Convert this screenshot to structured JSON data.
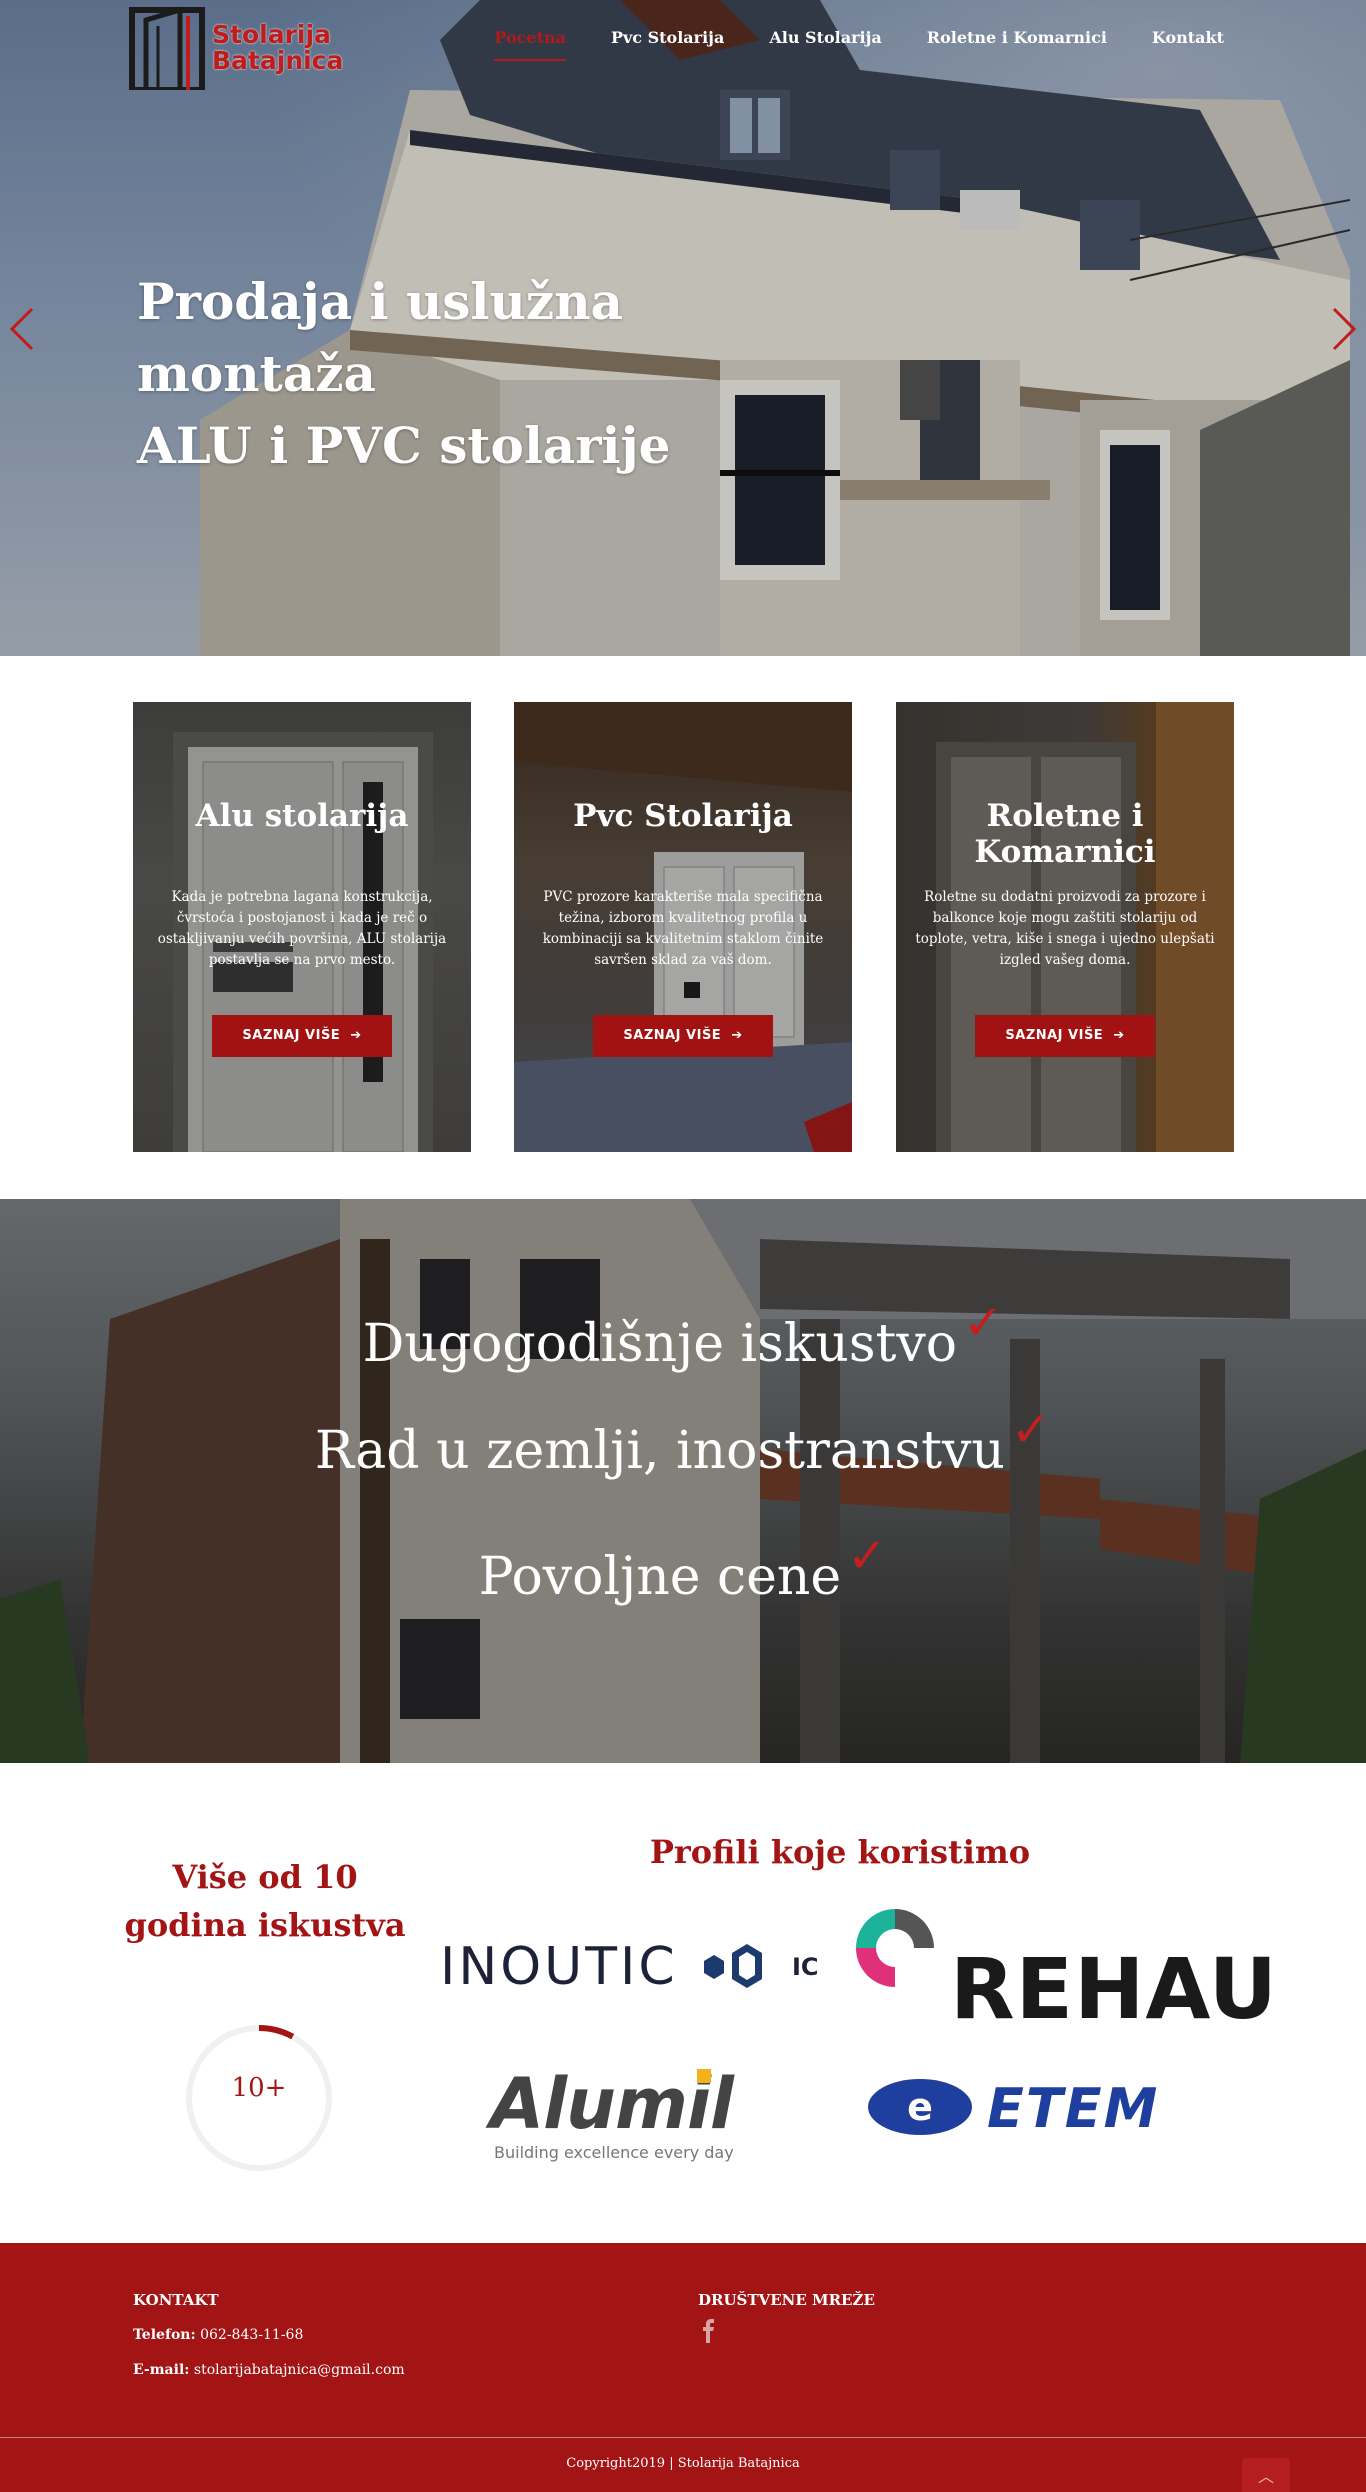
{
  "header": {
    "logo": {
      "line1": "Stolarija",
      "line2": "Batajnica"
    },
    "nav": [
      {
        "label": "Pocetna",
        "active": true
      },
      {
        "label": "Pvc Stolarija",
        "active": false
      },
      {
        "label": "Alu Stolarija",
        "active": false
      },
      {
        "label": "Roletne i Komarnici",
        "active": false
      },
      {
        "label": "Kontakt",
        "active": false
      }
    ]
  },
  "hero": {
    "line1": "Prodaja i uslužna montaža",
    "line2": "ALU i PVC stolarije",
    "prev_icon": "chevron-left-icon",
    "next_icon": "chevron-right-icon"
  },
  "cards": [
    {
      "title": "Alu stolarija",
      "text": "Kada je potrebna lagana konstrukcija, čvrstoća i postojanost i kada je reč o ostakljivanju većih površina, ALU stolarija postavlja se na prvo mesto.",
      "button": "SAZNAJ VIŠE"
    },
    {
      "title": "Pvc Stolarija",
      "text": "PVC prozore karakteriše mala specifična težina, izborom kvalitetnog profila u kombinaciji sa kvalitetnim staklom činite savršen sklad za vaš dom.",
      "button": "SAZNAJ VIŠE"
    },
    {
      "title": "Roletne i Komarnici",
      "text": "Roletne su dodatni proizvodi za prozore i balkonce koje mogu zaštiti stolariju od toplote, vetra, kiše i snega i ujedno ulepšati izgled vašeg doma.",
      "button": "SAZNAJ VIŠE"
    }
  ],
  "band": {
    "lines": [
      "Dugogodišnje iskustvo",
      "Rad u zemlji, inostranstvu",
      "Povoljne cene"
    ],
    "check": "✓"
  },
  "stats": {
    "experience_title": "Više od 10 godina iskustva",
    "counter": "10+",
    "counter_progress": 0.08,
    "profiles_title": "Profili koje koristimo",
    "brands": {
      "inoutic": "INOUTIC",
      "inoutic_suffix": "IC",
      "rehau": "REHAU",
      "alumil": "Alumil",
      "alumil_tagline": "Building excellence every day",
      "etem": "ETEM"
    }
  },
  "footer": {
    "contact_heading": "KONTAKT",
    "phone_label": "Telefon:",
    "phone": "062-843-11-68",
    "email_label": "E-mail:",
    "email": "stolarijabatajnica@gmail.com",
    "social_heading": "DRUŠTVENE MREŽE",
    "social_icon": "facebook-icon",
    "copyright": "Copyright2019 | Stolarija Batajnica",
    "to_top_icon": "chevron-up-icon"
  },
  "colors": {
    "brand_red": "#a31515",
    "button_red": "#a31212",
    "white": "#ffffff"
  }
}
